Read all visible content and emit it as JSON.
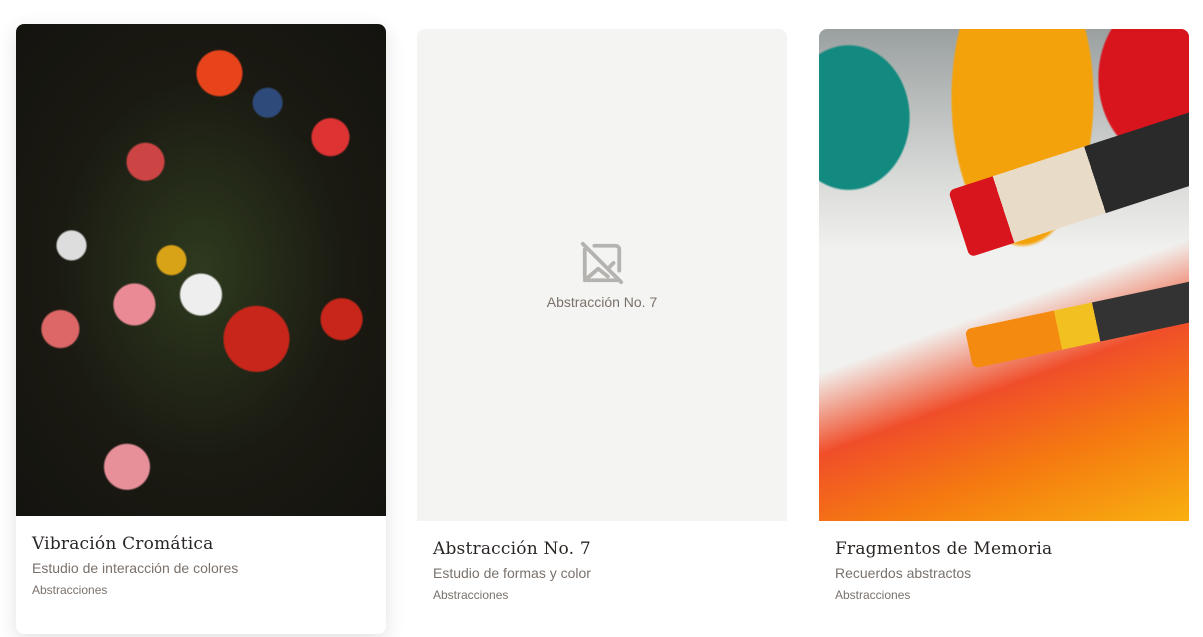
{
  "cards": [
    {
      "title": "Vibración Cromática",
      "subtitle": "Estudio de interacción de colores",
      "category": "Abstracciones",
      "image": "floral-still-life-painting"
    },
    {
      "title": "Abstracción No. 7",
      "subtitle": "Estudio de formas y color",
      "category": "Abstracciones",
      "image": "placeholder",
      "placeholder_label": "Abstracción No. 7",
      "placeholder_icon": "image-off-icon"
    },
    {
      "title": "Fragmentos de Memoria",
      "subtitle": "Recuerdos abstractos",
      "category": "Abstracciones",
      "image": "paint-brushes-photo"
    }
  ]
}
